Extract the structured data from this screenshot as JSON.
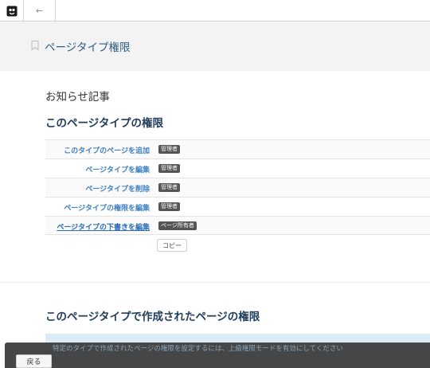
{
  "topbar": {
    "logo_icon": "app-logo-icon",
    "back_icon": "arrow-left-icon",
    "back_glyph": "←"
  },
  "header": {
    "bookmark_icon": "bookmark-icon",
    "title": "ページタイプ権限"
  },
  "page": {
    "subtitle": "お知らせ記事",
    "section1_heading": "このページタイプの権限",
    "section2_heading": "このページタイプで作成されたページの権限"
  },
  "permissions": [
    {
      "label": "このタイプのページを追加",
      "badge": "管理者"
    },
    {
      "label": "ページタイプを編集",
      "badge": "管理者"
    },
    {
      "label": "ページタイプを削除",
      "badge": "管理者"
    },
    {
      "label": "ページタイプの権限を編集",
      "badge": "管理者"
    },
    {
      "label": "ページタイプの下書きを編集",
      "badge": "ページ所有者"
    }
  ],
  "copy_button": "コピー",
  "info_message": "特定のタイプで作成されたページの権限を設定するには、上級権限モードを有効にしてください",
  "footer": {
    "back_button": "戻る"
  },
  "colors": {
    "link": "#3d7fc1",
    "heading": "#1f3b5b",
    "header_title": "#2d5b86",
    "badge_bg": "#555555",
    "info_bg": "#d9ebf7"
  }
}
